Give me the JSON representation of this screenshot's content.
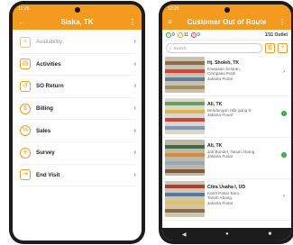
{
  "left": {
    "time": "12:26",
    "back_icon": "back-arrow-icon",
    "title": "Siska, TK",
    "more": "⋮",
    "menu": [
      {
        "label": "Availability",
        "icon": "check-list-icon",
        "glyph": "≡",
        "disabled": true
      },
      {
        "label": "Activities",
        "icon": "activity-icon",
        "glyph": "▤"
      },
      {
        "label": "SO Return",
        "icon": "return-icon",
        "glyph": "↺"
      },
      {
        "label": "Billing",
        "icon": "billing-icon",
        "glyph": "$"
      },
      {
        "label": "Sales",
        "icon": "sales-icon",
        "glyph": "%"
      },
      {
        "label": "Survey",
        "icon": "survey-icon",
        "glyph": "✳"
      },
      {
        "label": "End Visit",
        "icon": "end-visit-icon",
        "glyph": "⇥"
      }
    ]
  },
  "right": {
    "time": "12:26",
    "menu_icon": "hamburger-icon",
    "title": "Customer Out of Route",
    "more": "⋮",
    "counts": {
      "green": "0",
      "orange": "11",
      "red": "0"
    },
    "outlet": "1/11 Outlet",
    "search_placeholder": "Search",
    "customers": [
      {
        "name": "Hj. Sholeh, TK",
        "address": [
          "Kawasan Selatan,",
          "Cempaka Putih",
          "Jakarta Pusat"
        ],
        "status": "arrow"
      },
      {
        "name": "Ali, TK",
        "address": [
          "Bendungan Hilir gang 6",
          "Jakarta Pusat"
        ],
        "status": "ok"
      },
      {
        "name": "Ali, TK",
        "address": [
          "Jati Bunder, Tanah Abang,",
          "Jakarta Pusat"
        ],
        "status": "ok"
      },
      {
        "name": "Citra Usaha I, UD",
        "address": [
          "Karet Pasar Baru,",
          "Tanah Abang,",
          "Jakarta Pusat"
        ],
        "status": "arrow"
      }
    ]
  },
  "colors": {
    "accent": "#f39a1f",
    "ok": "#2eaa3f",
    "alert": "#e53935"
  }
}
